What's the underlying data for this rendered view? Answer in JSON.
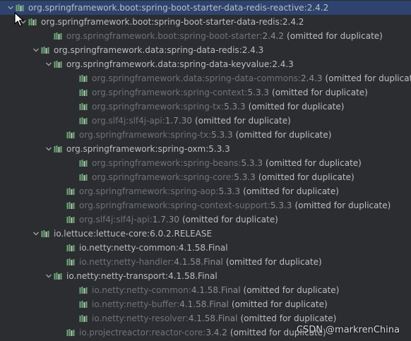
{
  "tree": {
    "rows": [
      {
        "group": "org.springframework.boot",
        "artifact": "spring-boot-starter-data-redis-reactive",
        "version": "2.4.2",
        "note": "",
        "expanded": true,
        "selected": true,
        "omitted": false
      },
      {
        "group": "org.springframework.boot",
        "artifact": "spring-boot-starter-data-redis",
        "version": "2.4.2",
        "note": "",
        "expanded": true,
        "selected": false,
        "omitted": false
      },
      {
        "group": "org.springframework.boot",
        "artifact": "spring-boot-starter",
        "version": "2.4.2",
        "note": "(omitted for duplicate)",
        "expanded": false,
        "selected": false,
        "omitted": true
      },
      {
        "group": "org.springframework.data",
        "artifact": "spring-data-redis",
        "version": "2.4.3",
        "note": "",
        "expanded": true,
        "selected": false,
        "omitted": false
      },
      {
        "group": "org.springframework.data",
        "artifact": "spring-data-keyvalue",
        "version": "2.4.3",
        "note": "",
        "expanded": true,
        "selected": false,
        "omitted": false
      },
      {
        "group": "org.springframework.data",
        "artifact": "spring-data-commons",
        "version": "2.4.3",
        "note": "(omitted for duplicate)",
        "expanded": false,
        "selected": false,
        "omitted": true
      },
      {
        "group": "org.springframework",
        "artifact": "spring-context",
        "version": "5.3.3",
        "note": "(omitted for duplicate)",
        "expanded": false,
        "selected": false,
        "omitted": true
      },
      {
        "group": "org.springframework",
        "artifact": "spring-tx",
        "version": "5.3.3",
        "note": "(omitted for duplicate)",
        "expanded": false,
        "selected": false,
        "omitted": true
      },
      {
        "group": "org.slf4j",
        "artifact": "slf4j-api",
        "version": "1.7.30",
        "note": "(omitted for duplicate)",
        "expanded": false,
        "selected": false,
        "omitted": true
      },
      {
        "group": "org.springframework",
        "artifact": "spring-tx",
        "version": "5.3.3",
        "note": "(omitted for duplicate)",
        "expanded": false,
        "selected": false,
        "omitted": true
      },
      {
        "group": "org.springframework",
        "artifact": "spring-oxm",
        "version": "5.3.3",
        "note": "",
        "expanded": true,
        "selected": false,
        "omitted": false
      },
      {
        "group": "org.springframework",
        "artifact": "spring-beans",
        "version": "5.3.3",
        "note": "(omitted for duplicate)",
        "expanded": false,
        "selected": false,
        "omitted": true
      },
      {
        "group": "org.springframework",
        "artifact": "spring-core",
        "version": "5.3.3",
        "note": "(omitted for duplicate)",
        "expanded": false,
        "selected": false,
        "omitted": true
      },
      {
        "group": "org.springframework",
        "artifact": "spring-aop",
        "version": "5.3.3",
        "note": "(omitted for duplicate)",
        "expanded": false,
        "selected": false,
        "omitted": true
      },
      {
        "group": "org.springframework",
        "artifact": "spring-context-support",
        "version": "5.3.3",
        "note": "(omitted for duplicate)",
        "expanded": false,
        "selected": false,
        "omitted": true
      },
      {
        "group": "org.slf4j",
        "artifact": "slf4j-api",
        "version": "1.7.30",
        "note": "(omitted for duplicate)",
        "expanded": false,
        "selected": false,
        "omitted": true
      },
      {
        "group": "io.lettuce",
        "artifact": "lettuce-core",
        "version": "6.0.2.RELEASE",
        "note": "",
        "expanded": true,
        "selected": false,
        "omitted": false
      },
      {
        "group": "io.netty",
        "artifact": "netty-common",
        "version": "4.1.58.Final",
        "note": "",
        "expanded": false,
        "selected": false,
        "omitted": false
      },
      {
        "group": "io.netty",
        "artifact": "netty-handler",
        "version": "4.1.58.Final",
        "note": "(omitted for duplicate)",
        "expanded": false,
        "selected": false,
        "omitted": true
      },
      {
        "group": "io.netty",
        "artifact": "netty-transport",
        "version": "4.1.58.Final",
        "note": "",
        "expanded": true,
        "selected": false,
        "omitted": false
      },
      {
        "group": "io.netty",
        "artifact": "netty-common",
        "version": "4.1.58.Final",
        "note": "(omitted for duplicate)",
        "expanded": false,
        "selected": false,
        "omitted": true
      },
      {
        "group": "io.netty",
        "artifact": "netty-buffer",
        "version": "4.1.58.Final",
        "note": "(omitted for duplicate)",
        "expanded": false,
        "selected": false,
        "omitted": true
      },
      {
        "group": "io.netty",
        "artifact": "netty-resolver",
        "version": "4.1.58.Final",
        "note": "(omitted for duplicate)",
        "expanded": false,
        "selected": false,
        "omitted": true
      },
      {
        "group": "io.projectreactor",
        "artifact": "reactor-core",
        "version": "3.4.2",
        "note": "(omitted for duplicate)",
        "expanded": false,
        "selected": false,
        "omitted": true
      }
    ]
  },
  "watermark": "CSDN @markrenChina",
  "colors": {
    "background": "#2b2d30",
    "selection": "#2e436e",
    "text": "#bcbec4",
    "dim_text": "#6f737a",
    "library_icon": "#6aab73"
  },
  "icons": {
    "expanded": "chevron-down-icon",
    "library": "library-icon",
    "cursor": "mouse-cursor-icon"
  }
}
